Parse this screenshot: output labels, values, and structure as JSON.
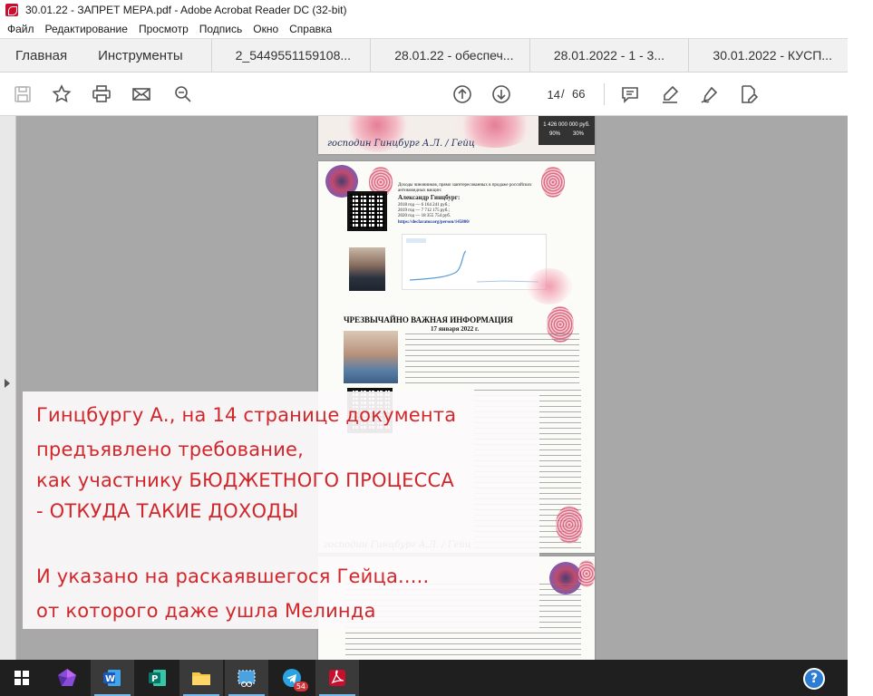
{
  "window": {
    "title": "30.01.22 - ЗАПРЕТ  МЕРА.pdf - Adobe Acrobat Reader DC (32-bit)"
  },
  "menu": [
    "Файл",
    "Редактирование",
    "Просмотр",
    "Подпись",
    "Окно",
    "Справка"
  ],
  "nav_tabs": [
    "Главная",
    "Инструменты"
  ],
  "doc_tabs": [
    "2_5449551159108...",
    "28.01.22 - обеспеч...",
    "28.01.2022 - 1 - 3...",
    "30.01.2022 - КУСП..."
  ],
  "toolbar": {
    "page_current": "14",
    "page_separator": "/",
    "page_total": "66",
    "icons": [
      "save-icon",
      "bookmark-star-icon",
      "print-icon",
      "email-icon",
      "zoom-search-icon",
      "page-up-icon",
      "page-down-icon",
      "comment-icon",
      "highlight-icon",
      "sign-icon",
      "fill-sign-icon"
    ]
  },
  "document": {
    "p2": {
      "heading": "Александр Гинцбург:",
      "incomes": [
        "2018 год — 6 164 241 руб.;",
        "2019 год — 7 712 175 руб.;",
        "2020 год — 18 355 754 руб."
      ],
      "link": "https://declarator.org/person/145800/",
      "main_heading": "ЧРЕЗВЫЧАЙНО ВАЖНАЯ ИНФОРМАЦИЯ",
      "date": "17 января 2022 г."
    },
    "p1_badge": {
      "top": "1 426 000 000 руб.",
      "left": "90%",
      "right": "30%"
    }
  },
  "annotation": {
    "lines": [
      "Гинцбургу А., на 14 странице документа",
      "предъявлено требование,",
      "как участнику БЮДЖЕТНОГО ПРОЦЕССА",
      "- ОТКУДА ТАКИЕ ДОХОДЫ",
      "И указано на раскаявшегося Гейца.....",
      " от которого даже ушла Мелинда"
    ],
    "color": "#d3262b"
  },
  "taskbar": {
    "telegram_badge": "54",
    "help": "?"
  }
}
